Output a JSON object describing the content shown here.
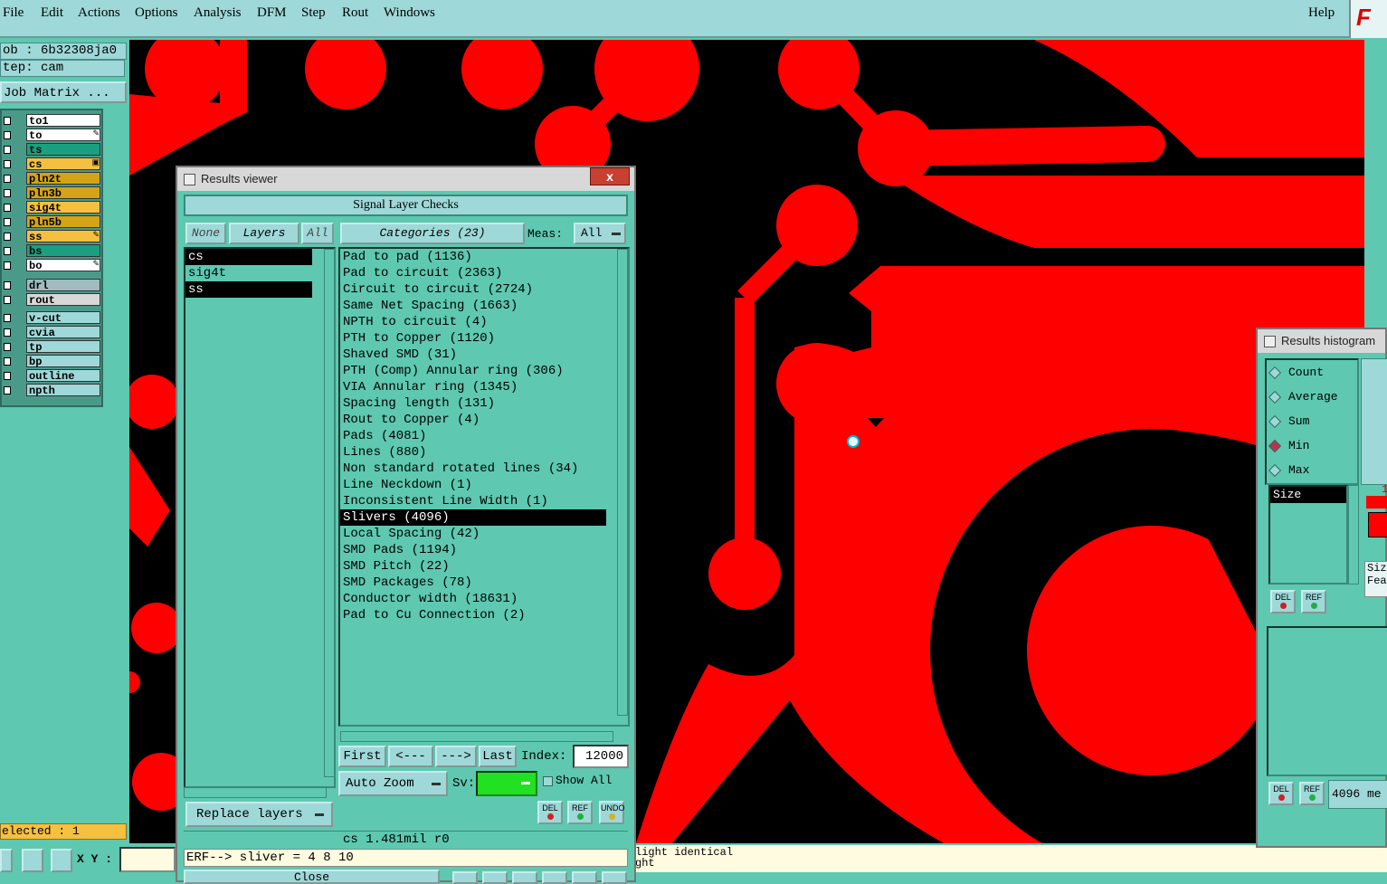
{
  "menu": {
    "file": "File",
    "edit": "Edit",
    "actions": "Actions",
    "options": "Options",
    "analysis": "Analysis",
    "dfm": "DFM",
    "step": "Step",
    "rout": "Rout",
    "windows": "Windows",
    "help": "Help"
  },
  "logo_text": "F",
  "left": {
    "job": "ob : 6b32308ja0",
    "step": "tep: cam",
    "job_matrix": "Job Matrix ...",
    "selected": "elected : 1",
    "xy_label": "X Y :",
    "layers": [
      {
        "name": "to1",
        "color": "#ffffff"
      },
      {
        "name": "to",
        "color": "#ffffff",
        "mark": "✎"
      },
      {
        "name": "ts",
        "color": "#1aa080"
      },
      {
        "name": "cs",
        "color": "#f5c040",
        "mark": "▣"
      },
      {
        "name": "pln2t",
        "color": "#d4a418"
      },
      {
        "name": "pln3b",
        "color": "#d4a418"
      },
      {
        "name": "sig4t",
        "color": "#f5c040"
      },
      {
        "name": "pln5b",
        "color": "#d4a418"
      },
      {
        "name": "ss",
        "color": "#f5c040",
        "mark": "✎"
      },
      {
        "name": "bs",
        "color": "#1aa080"
      },
      {
        "name": "bo",
        "color": "#ffffff",
        "mark": "✎"
      },
      {
        "name": "drl",
        "color": "#a0bcc0"
      },
      {
        "name": "rout",
        "color": "#d8d8d8"
      },
      {
        "name": "v-cut",
        "color": "#9ed8d8"
      },
      {
        "name": "cvia",
        "color": "#9ed8d8"
      },
      {
        "name": "tp",
        "color": "#9ed8d8"
      },
      {
        "name": "bp",
        "color": "#9ed8d8"
      },
      {
        "name": "outline",
        "color": "#9ed8d8"
      },
      {
        "name": "npth",
        "color": "#9ed8d8"
      }
    ]
  },
  "results_viewer": {
    "title": "Results viewer",
    "close_x": "x",
    "heading": "Signal Layer Checks",
    "none": "None",
    "layers": "Layers",
    "all": "All",
    "categories_header": "Categories (23)",
    "meas_label": "Meas:",
    "meas_value": "All",
    "layer_list": [
      {
        "name": "cs",
        "selected": true
      },
      {
        "name": "sig4t",
        "selected": false
      },
      {
        "name": "ss",
        "selected": true
      }
    ],
    "categories": [
      "Pad to pad (1136)",
      "Pad to circuit (2363)",
      "Circuit to circuit (2724)",
      "Same Net Spacing (1663)",
      "NPTH to circuit (4)",
      "PTH to Copper (1120)",
      "Shaved SMD (31)",
      "PTH (Comp) Annular ring (306)",
      "VIA Annular ring (1345)",
      "Spacing length (131)",
      "Rout to Copper (4)",
      "Pads (4081)",
      "Lines (880)",
      "Non standard rotated lines (34)",
      "Line Neckdown (1)",
      "Inconsistent Line Width (1)",
      "Slivers (4096)",
      "Local Spacing (42)",
      "SMD Pads (1194)",
      "SMD Pitch (22)",
      "SMD Packages (78)",
      "Conductor width (18631)",
      "Pad to Cu Connection (2)"
    ],
    "selected_category": "Slivers (4096)",
    "first": "First",
    "prev": "<---",
    "next": "--->",
    "last": "Last",
    "index_label": "Index:",
    "index_value": "12000",
    "auto_zoom": "Auto Zoom",
    "sv_label": "Sv:",
    "show_all": "Show All",
    "replace_layers": "Replace layers",
    "del": "DEL",
    "ref": "REF",
    "undo": "UNDO",
    "status": "cs 1.481mil  r0",
    "erf": "ERF--> sliver = 4 8 10",
    "close_btn": "Close"
  },
  "histogram": {
    "title": "Results histogram",
    "options": [
      {
        "label": "Count",
        "on": false
      },
      {
        "label": "Average",
        "on": false
      },
      {
        "label": "Sum",
        "on": false
      },
      {
        "label": "Min",
        "on": true
      },
      {
        "label": "Max",
        "on": false
      }
    ],
    "size": "Size",
    "del": "DEL",
    "ref": "REF",
    "count_text": "4096 me",
    "side1": "Siz",
    "side2": "Fea",
    "side_num": "1"
  },
  "messages": {
    "line1": "light identical",
    "line2": "ght"
  },
  "colors": {
    "copper": "#ff0000",
    "board": "#000000",
    "ui_teal": "#5ec8b0",
    "ui_light": "#9ed8d8"
  }
}
